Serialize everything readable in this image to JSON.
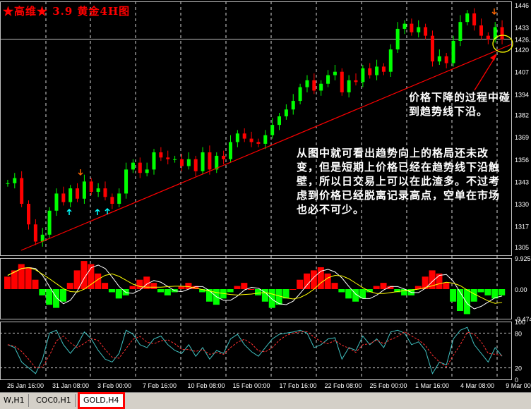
{
  "header": {
    "title": "★高维★  3.9  黄金4H图"
  },
  "annotations": {
    "note_price_line": "价格下降的过程中碰到趋势线下沿。",
    "note_main": "从图中就可看出趋势向上的格局还未改变，但是短期上价格已经在趋势线下沿触壁，所以日交易上可以在此渣多。不过考虑到价格已经脱离记录高点，空单在市场也必不可少。"
  },
  "tabs": [
    {
      "label": "W,H1",
      "active": false
    },
    {
      "label": "COC0,H1",
      "active": false
    },
    {
      "label": "GOLD,H4",
      "active": true
    }
  ],
  "colors": {
    "up": "#00ff00",
    "down": "#ff0000",
    "grid": "#ffffff",
    "trend": "#ff0000",
    "fast": "#ffffff",
    "slow": "#ffff00"
  },
  "chart_data": [
    {
      "type": "candlestick",
      "title": "GOLD,H4",
      "ylim": [
        1300,
        1448
      ],
      "y_ticks": [
        "1305",
        "1317",
        "1330",
        "1343",
        "1356",
        "1369",
        "1382",
        "1394",
        "1407",
        "1420",
        "1426.",
        "1433",
        "1446"
      ],
      "current_price": 1426,
      "x_ticks": [
        "26 Jan 16:00",
        "31 Jan 08:00",
        "3 Feb 00:00",
        "7 Feb 16:00",
        "10 Feb 08:00",
        "15 Feb 00:00",
        "17 Feb 16:00",
        "22 Feb 08:00",
        "25 Feb 00:00",
        "1 Mar 16:00",
        "4 Mar 08:00",
        "9 Mar 00"
      ],
      "close_path": [
        1342,
        1345,
        1330,
        1318,
        1308,
        1312,
        1326,
        1336,
        1331,
        1339,
        1333,
        1343,
        1337,
        1339,
        1334,
        1330,
        1336,
        1350,
        1354,
        1348,
        1350,
        1360,
        1357,
        1356,
        1356,
        1352,
        1356,
        1349,
        1360,
        1350,
        1358,
        1356,
        1366,
        1371,
        1368,
        1366,
        1365,
        1370,
        1376,
        1381,
        1385,
        1390,
        1398,
        1402,
        1396,
        1400,
        1405,
        1407,
        1395,
        1402,
        1401,
        1409,
        1405,
        1410,
        1407,
        1420,
        1432,
        1435,
        1430,
        1433,
        1428,
        1413,
        1416,
        1412,
        1425,
        1436,
        1441,
        1434,
        1428,
        1426,
        1433,
        1426
      ]
    },
    {
      "type": "histogram",
      "name": "MACD",
      "ylim": [
        -9.474,
        9.925
      ],
      "y_ticks": [
        "9.925",
        "0.00",
        "-9.474"
      ],
      "values": [
        4,
        6,
        8,
        7,
        3,
        -2,
        -5,
        -6,
        -4,
        2,
        6,
        9,
        8,
        5,
        2,
        -1,
        -3,
        -2,
        1,
        3,
        4,
        2,
        -1,
        -2,
        -1,
        1,
        2,
        1,
        -1,
        -4,
        -5,
        -3,
        -1,
        1,
        2,
        0,
        -2,
        -4,
        -6,
        -5,
        -3,
        0,
        3,
        5,
        6,
        7,
        5,
        2,
        -1,
        -3,
        -4,
        -3,
        -1,
        1,
        2,
        1,
        -1,
        -2,
        -2,
        1,
        4,
        6,
        5,
        2,
        -4,
        -7,
        -8,
        -4,
        -1,
        -2,
        -3,
        -2
      ]
    },
    {
      "type": "line",
      "name": "Stochastic",
      "ylim": [
        0,
        100
      ],
      "y_ticks": [
        "100",
        "80",
        "20",
        "0"
      ],
      "values": [
        60,
        55,
        30,
        20,
        10,
        35,
        80,
        85,
        60,
        45,
        60,
        82,
        70,
        50,
        35,
        30,
        45,
        85,
        78,
        60,
        55,
        70,
        75,
        60,
        50,
        45,
        60,
        40,
        55,
        35,
        50,
        45,
        70,
        78,
        60,
        48,
        40,
        55,
        70,
        78,
        80,
        82,
        85,
        80,
        55,
        60,
        70,
        72,
        35,
        55,
        50,
        75,
        60,
        70,
        55,
        82,
        85,
        80,
        60,
        65,
        50,
        10,
        30,
        25,
        70,
        85,
        90,
        60,
        45,
        30,
        55,
        40
      ]
    }
  ]
}
